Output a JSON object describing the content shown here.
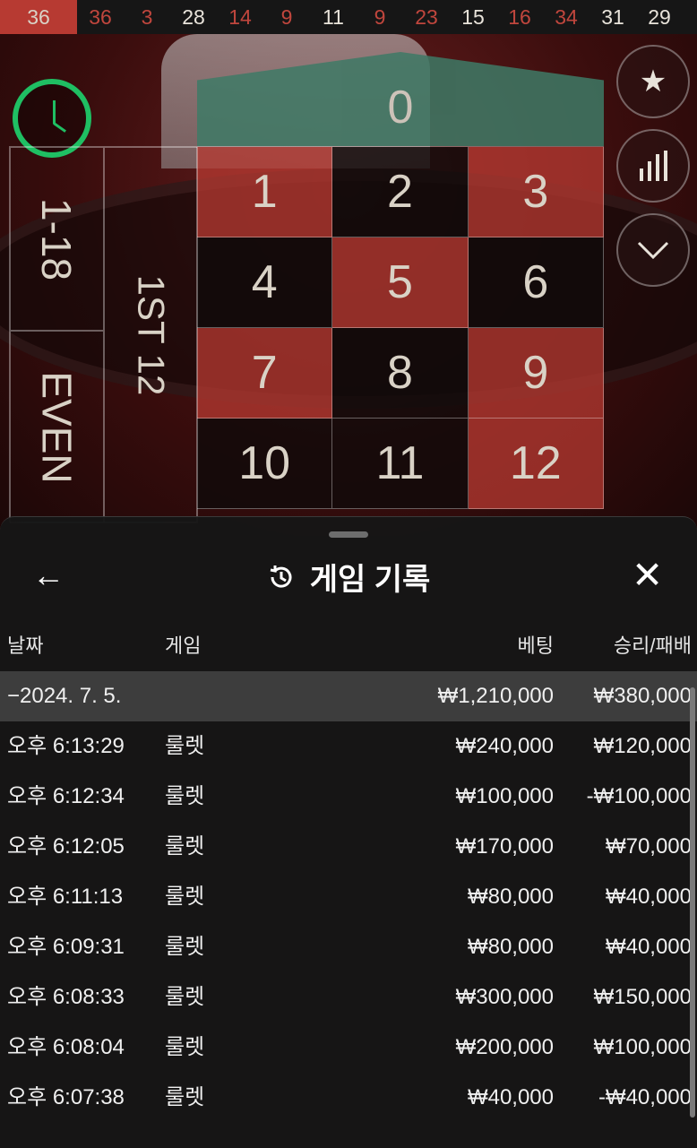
{
  "results_strip": [
    {
      "value": "36",
      "color": "red"
    },
    {
      "value": "36",
      "color": "red"
    },
    {
      "value": "3",
      "color": "red"
    },
    {
      "value": "28",
      "color": "black"
    },
    {
      "value": "14",
      "color": "red"
    },
    {
      "value": "9",
      "color": "red"
    },
    {
      "value": "11",
      "color": "black"
    },
    {
      "value": "9",
      "color": "red"
    },
    {
      "value": "23",
      "color": "red"
    },
    {
      "value": "15",
      "color": "black"
    },
    {
      "value": "16",
      "color": "red"
    },
    {
      "value": "34",
      "color": "red"
    },
    {
      "value": "31",
      "color": "black"
    },
    {
      "value": "29",
      "color": "black"
    }
  ],
  "table": {
    "zero": "0",
    "numbers": [
      {
        "n": "1",
        "color": "red"
      },
      {
        "n": "2",
        "color": "black"
      },
      {
        "n": "3",
        "color": "red"
      },
      {
        "n": "4",
        "color": "black"
      },
      {
        "n": "5",
        "color": "red"
      },
      {
        "n": "6",
        "color": "black"
      },
      {
        "n": "7",
        "color": "red"
      },
      {
        "n": "8",
        "color": "black"
      },
      {
        "n": "9",
        "color": "red"
      },
      {
        "n": "10",
        "color": "black"
      },
      {
        "n": "11",
        "color": "black"
      },
      {
        "n": "12",
        "color": "red"
      }
    ],
    "outside": {
      "low": "1-18",
      "even": "EVEN",
      "dozen": "1ST 12"
    }
  },
  "side_buttons": [
    "star-icon",
    "stats-icon",
    "chevron-down-icon"
  ],
  "panel": {
    "title": "게임 기록",
    "back_label": "←",
    "close_label": "✕",
    "headers": {
      "date": "날짜",
      "game": "게임",
      "bet": "베팅",
      "win": "승리/패배"
    },
    "total": {
      "date": "−2024. 7. 5.",
      "bet": "₩1,210,000",
      "win": "₩380,000"
    },
    "rows": [
      {
        "date": "오후 6:13:29",
        "game": "룰렛",
        "bet": "₩240,000",
        "win": "₩120,000"
      },
      {
        "date": "오후 6:12:34",
        "game": "룰렛",
        "bet": "₩100,000",
        "win": "-₩100,000"
      },
      {
        "date": "오후 6:12:05",
        "game": "룰렛",
        "bet": "₩170,000",
        "win": "₩70,000"
      },
      {
        "date": "오후 6:11:13",
        "game": "룰렛",
        "bet": "₩80,000",
        "win": "₩40,000"
      },
      {
        "date": "오후 6:09:31",
        "game": "룰렛",
        "bet": "₩80,000",
        "win": "₩40,000"
      },
      {
        "date": "오후 6:08:33",
        "game": "룰렛",
        "bet": "₩300,000",
        "win": "₩150,000"
      },
      {
        "date": "오후 6:08:04",
        "game": "룰렛",
        "bet": "₩200,000",
        "win": "₩100,000"
      },
      {
        "date": "오후 6:07:38",
        "game": "룰렛",
        "bet": "₩40,000",
        "win": "-₩40,000"
      }
    ]
  },
  "colors": {
    "red": "#b73a32",
    "black": "#0f0a0a",
    "green": "#3e7a66",
    "timer": "#1fbf63"
  }
}
